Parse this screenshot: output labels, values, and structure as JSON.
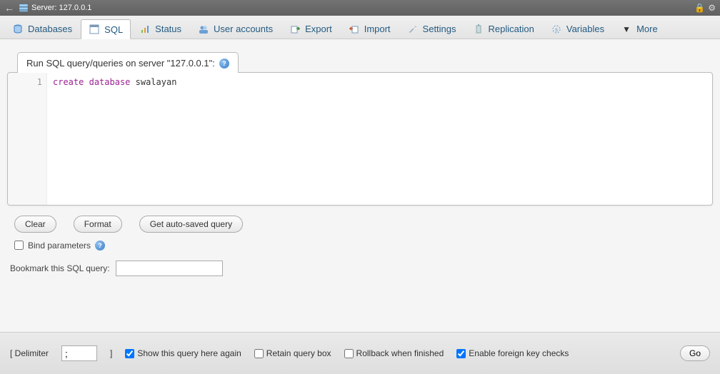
{
  "titlebar": {
    "server_label": "Server: 127.0.0.1"
  },
  "tabs": {
    "databases": "Databases",
    "sql": "SQL",
    "status": "Status",
    "user_accounts": "User accounts",
    "export": "Export",
    "import": "Import",
    "settings": "Settings",
    "replication": "Replication",
    "variables": "Variables",
    "more": "More"
  },
  "panel": {
    "title": "Run SQL query/queries on server \"127.0.0.1\":"
  },
  "editor": {
    "line_number": "1",
    "kw1": "create",
    "kw2": "database",
    "ident": "swalayan"
  },
  "buttons": {
    "clear": "Clear",
    "format": "Format",
    "autosaved": "Get auto-saved query"
  },
  "options": {
    "bind_parameters": "Bind parameters"
  },
  "bookmark": {
    "label": "Bookmark this SQL query:",
    "value": ""
  },
  "footer": {
    "delimiter_label_open": "[ Delimiter",
    "delimiter_value": ";",
    "delimiter_label_close": "]",
    "show_again": "Show this query here again",
    "retain": "Retain query box",
    "rollback": "Rollback when finished",
    "fk": "Enable foreign key checks",
    "go": "Go",
    "checked": {
      "show_again": true,
      "retain": false,
      "rollback": false,
      "fk": true
    }
  }
}
